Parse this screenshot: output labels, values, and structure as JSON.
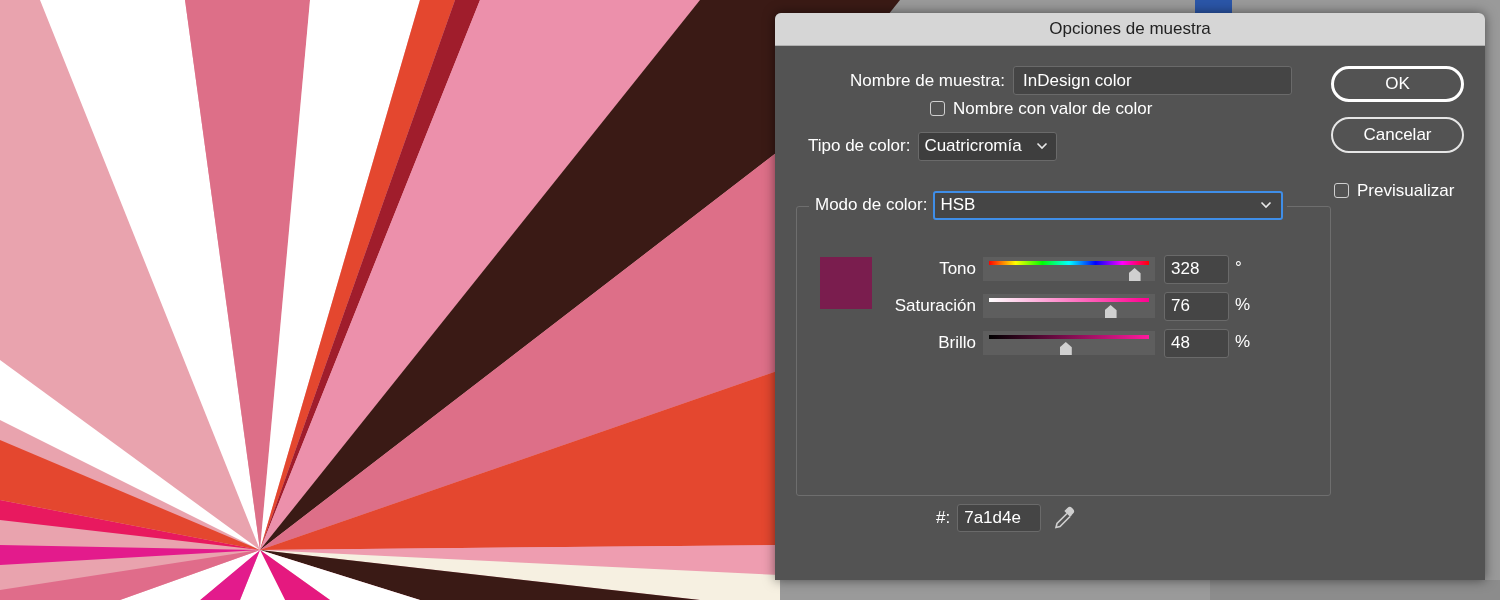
{
  "dialog": {
    "title": "Opciones de muestra",
    "swatch_name": {
      "label": "Nombre de muestra:",
      "value": "InDesign color"
    },
    "name_with_value": {
      "label": "Nombre con valor de color",
      "checked": false
    },
    "color_type": {
      "label": "Tipo de color:",
      "value": "Cuatricromía"
    },
    "color_mode": {
      "label": "Modo de color:",
      "value": "HSB"
    },
    "swatch": {
      "color": "#7a1d4e"
    },
    "sliders": [
      {
        "kind": "hue",
        "label": "Tono",
        "level": 0.91,
        "reading": "328",
        "unit": "°"
      },
      {
        "kind": "saturation",
        "label": "Saturación",
        "level": 0.76,
        "reading": "76",
        "unit": "%"
      },
      {
        "kind": "brightness",
        "label": "Brillo",
        "level": 0.48,
        "reading": "48",
        "unit": "%"
      }
    ],
    "hex": {
      "label": "#:",
      "value": "7a1d4e"
    },
    "buttons": [
      {
        "label": "OK",
        "default": true
      },
      {
        "label": "Cancelar",
        "default": false
      }
    ],
    "preview": {
      "label": "Previsualizar",
      "checked": false
    }
  }
}
